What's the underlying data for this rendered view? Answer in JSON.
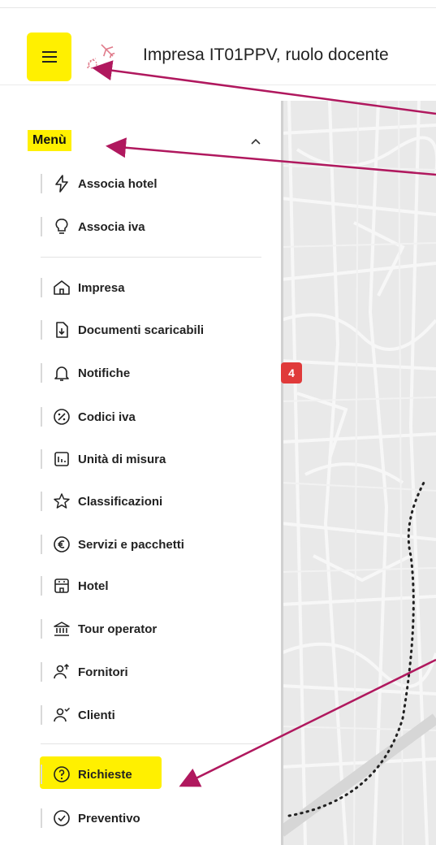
{
  "header": {
    "title": "Impresa IT01PPV, ruolo docente"
  },
  "sidebar": {
    "menu_title": "Menù",
    "group1": [
      {
        "label": "Associa hotel",
        "icon": "lightning-icon"
      },
      {
        "label": "Associa iva",
        "icon": "lightbulb-icon"
      }
    ],
    "group2": [
      {
        "label": "Impresa",
        "icon": "home-icon"
      },
      {
        "label": "Documenti scaricabili",
        "icon": "document-download-icon"
      },
      {
        "label": "Notifiche",
        "icon": "bell-icon",
        "badge": "4"
      },
      {
        "label": "Codici iva",
        "icon": "percent-icon"
      },
      {
        "label": "Unità di misura",
        "icon": "bar-chart-icon"
      },
      {
        "label": "Classificazioni",
        "icon": "star-icon"
      },
      {
        "label": "Servizi e pacchetti",
        "icon": "euro-icon"
      },
      {
        "label": "Hotel",
        "icon": "hotel-icon"
      },
      {
        "label": "Tour operator",
        "icon": "bank-icon"
      },
      {
        "label": "Fornitori",
        "icon": "user-up-icon"
      },
      {
        "label": "Clienti",
        "icon": "user-check-icon"
      }
    ],
    "group3": [
      {
        "label": "Richieste",
        "icon": "question-circle-icon"
      },
      {
        "label": "Preventivo",
        "icon": "check-circle-icon"
      }
    ]
  },
  "colors": {
    "highlight": "#fff000",
    "arrow": "#b0185e",
    "badge": "#e03a3a"
  }
}
